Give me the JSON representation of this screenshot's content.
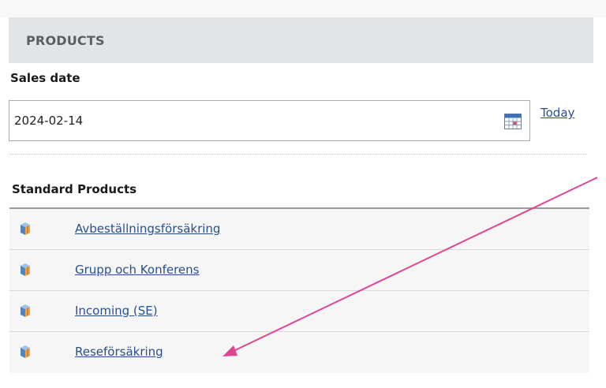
{
  "panel": {
    "title": "PRODUCTS"
  },
  "sales_date": {
    "label": "Sales date",
    "value": "2024-02-14",
    "today_label": "Today"
  },
  "standard_products": {
    "heading": "Standard Products",
    "items": [
      {
        "label": "Avbeställningsförsäkring",
        "icon": "product-box-icon"
      },
      {
        "label": "Grupp och Konferens",
        "icon": "product-box-icon"
      },
      {
        "label": "Incoming (SE)",
        "icon": "product-box-icon"
      },
      {
        "label": "Reseförsäkring",
        "icon": "product-box-icon"
      }
    ]
  },
  "colors": {
    "link": "#2a4f8f",
    "header_bg": "#e3e4e6",
    "annotation_arrow": "#e0458f"
  }
}
